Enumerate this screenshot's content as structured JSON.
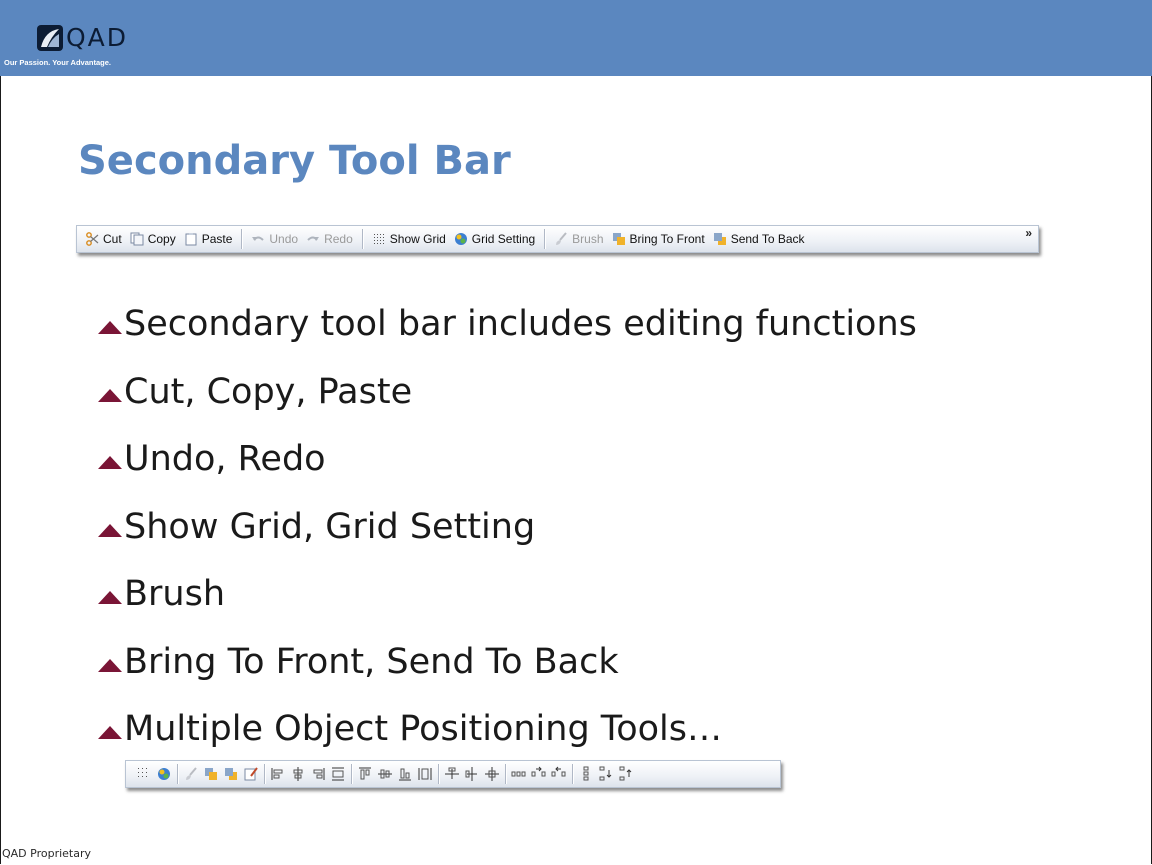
{
  "header": {
    "logo_text": "QAD",
    "tagline": "Our Passion. Your Advantage.",
    "brand_color": "#5b87bf"
  },
  "slide": {
    "title": "Secondary Tool Bar",
    "accent_color": "#7a1536"
  },
  "toolbar": {
    "items": [
      {
        "label": "Cut",
        "icon": "scissors-icon",
        "enabled": true
      },
      {
        "label": "Copy",
        "icon": "copy-icon",
        "enabled": true
      },
      {
        "label": "Paste",
        "icon": "paste-icon",
        "enabled": true
      },
      {
        "label": "Undo",
        "icon": "undo-icon",
        "enabled": false
      },
      {
        "label": "Redo",
        "icon": "redo-icon",
        "enabled": false
      },
      {
        "label": "Show Grid",
        "icon": "grid-icon",
        "enabled": true
      },
      {
        "label": "Grid Setting",
        "icon": "grid-setting-icon",
        "enabled": true
      },
      {
        "label": "Brush",
        "icon": "brush-icon",
        "enabled": false
      },
      {
        "label": "Bring To Front",
        "icon": "bring-to-front-icon",
        "enabled": true
      },
      {
        "label": "Send To Back",
        "icon": "send-to-back-icon",
        "enabled": true
      }
    ],
    "overflow": "»"
  },
  "bullets": [
    "Secondary tool bar includes editing functions",
    "Cut, Copy, Paste",
    "Undo, Redo",
    "Show Grid, Grid Setting",
    "Brush",
    "Bring To Front, Send To Back",
    "Multiple Object Positioning Tools…"
  ],
  "positioning_toolbar": {
    "icons": [
      "grid-icon",
      "grid-setting-icon",
      "brush-icon",
      "bring-to-front-icon",
      "send-to-back-icon",
      "format-painter-icon",
      "align-left-icon",
      "align-center-icon",
      "align-right-icon",
      "align-width-icon",
      "align-top-icon",
      "align-middle-icon",
      "align-bottom-icon",
      "align-height-icon",
      "center-horizontal-icon",
      "center-vertical-icon",
      "center-both-icon",
      "space-horizontal-icon",
      "space-horizontal-increase-icon",
      "space-horizontal-decrease-icon",
      "space-vertical-icon",
      "space-vertical-increase-icon",
      "space-vertical-decrease-icon"
    ]
  },
  "footer": {
    "text": "QAD Proprietary"
  }
}
